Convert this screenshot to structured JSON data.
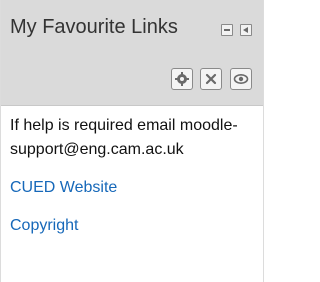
{
  "block": {
    "title": "My Favourite Links",
    "controls": {
      "dock_icon": "dock-icon",
      "hide_icon": "collapse-icon"
    },
    "actions": [
      {
        "icon": "gear-icon"
      },
      {
        "icon": "delete-icon"
      },
      {
        "icon": "eye-icon"
      }
    ]
  },
  "content": {
    "message": "If help is required email moodle-support@eng.cam.ac.uk",
    "links": [
      {
        "label": "CUED Website"
      },
      {
        "label": "Copyright"
      }
    ]
  },
  "colors": {
    "header_bg": "#dadada",
    "link": "#1668b9",
    "text": "#111111"
  }
}
